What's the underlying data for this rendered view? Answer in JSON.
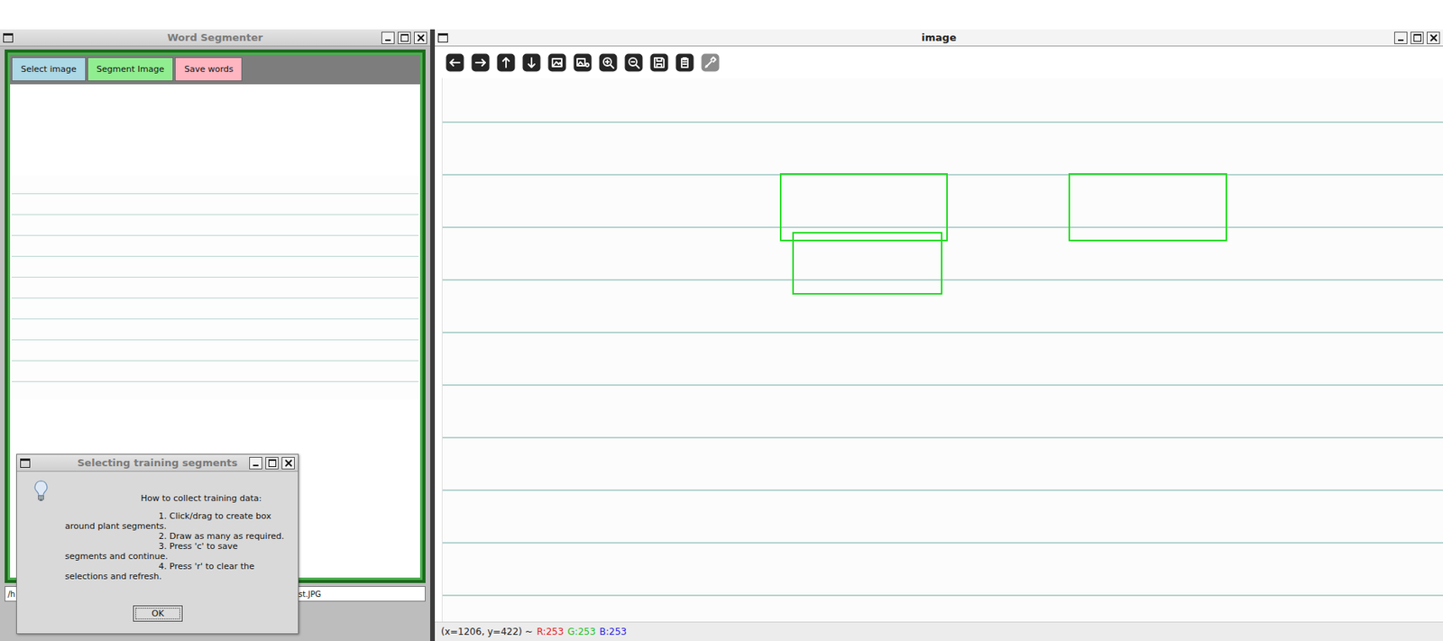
{
  "segmenter": {
    "title": "Word Segmenter",
    "buttons": [
      {
        "label": "Select image",
        "color": "#add8e6"
      },
      {
        "label": "Segment Image",
        "color": "#90ee90"
      },
      {
        "label": "Save words",
        "color": "#ffb6c1"
      }
    ],
    "path": {
      "visible_start": "/h",
      "visible_end": "est.JPG"
    }
  },
  "dialog": {
    "title": "Selecting training segments",
    "lines": [
      {
        "text": "How to collect training data:",
        "kind": "heading"
      },
      {
        "text": "1. Click/drag to create box",
        "kind": "step"
      },
      {
        "text": "around plant segments.",
        "kind": "continuation"
      },
      {
        "text": "2. Draw as many as required.",
        "kind": "step"
      },
      {
        "text": "3. Press 'c' to save",
        "kind": "step"
      },
      {
        "text": "segments and continue.",
        "kind": "continuation"
      },
      {
        "text": "4. Press 'r' to clear the",
        "kind": "step"
      },
      {
        "text": "selections and refresh.",
        "kind": "continuation"
      }
    ],
    "button": "OK"
  },
  "viewer": {
    "title": "image",
    "toolbar": [
      {
        "disabled": false
      },
      {
        "disabled": false
      },
      {
        "disabled": false
      },
      {
        "disabled": false
      },
      {
        "disabled": false
      },
      {
        "disabled": false
      },
      {
        "disabled": false
      },
      {
        "disabled": false
      },
      {
        "disabled": false
      },
      {
        "disabled": false
      },
      {
        "disabled": true
      }
    ],
    "status": {
      "position": "(x=1206, y=422) ~",
      "channels": [
        {
          "label": "R:253",
          "color": "#e02020"
        },
        {
          "label": "G:253",
          "color": "#1fbf1f"
        },
        {
          "label": "B:253",
          "color": "#2424e0"
        }
      ]
    }
  }
}
